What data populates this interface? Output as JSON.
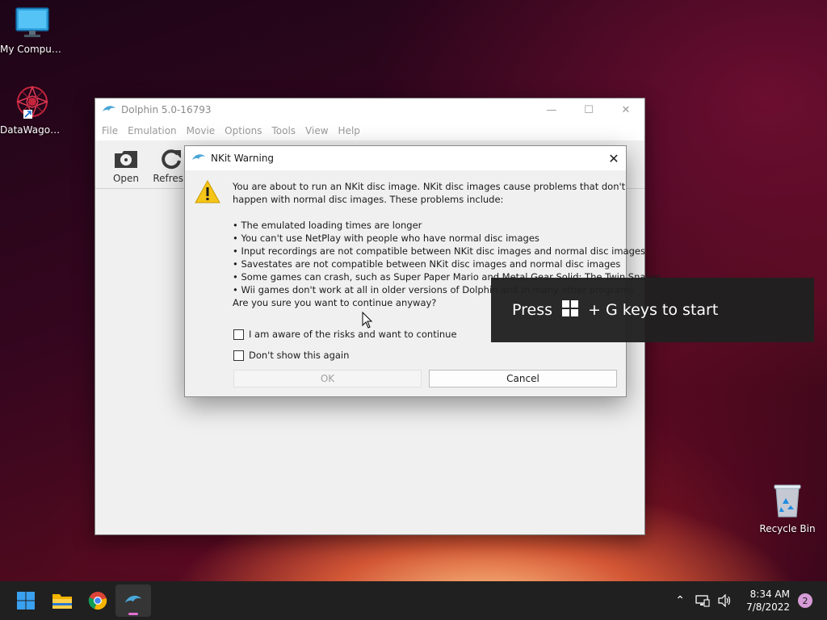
{
  "desktop": {
    "icons": [
      {
        "label": "My Computer"
      },
      {
        "label": "DataWagon..."
      },
      {
        "label": "Recycle Bin"
      }
    ]
  },
  "dolphin": {
    "title": "Dolphin 5.0-16793",
    "menu": [
      "File",
      "Emulation",
      "Movie",
      "Options",
      "Tools",
      "View",
      "Help"
    ],
    "toolbar": {
      "open_label": "Open",
      "refresh_label": "Refresh"
    }
  },
  "dialog": {
    "title": "NKit Warning",
    "intro_line1": "You are about to run an NKit disc image. NKit disc images cause problems that don't",
    "intro_line2": "happen with normal disc images. These problems include:",
    "bullets": [
      "The emulated loading times are longer",
      "You can't use NetPlay with people who have normal disc images",
      "Input recordings are not compatible between NKit disc images and normal disc images",
      "Savestates are not compatible between NKit disc images and normal disc images",
      "Some games can crash, such as Super Paper Mario and Metal Gear Solid: The Twin Snakes",
      "Wii games don't work at all in older versions of Dolphin and in many other programs"
    ],
    "question": "Are you sure you want to continue anyway?",
    "checkbox_aware": "I am aware of the risks and want to continue",
    "checkbox_dontshow": "Don't show this again",
    "ok_label": "OK",
    "cancel_label": "Cancel"
  },
  "toast": {
    "press": "Press",
    "rest": "+ G keys to start"
  },
  "taskbar": {
    "time": "8:34 AM",
    "date": "7/8/2022",
    "notification_count": "2"
  },
  "colors": {
    "taskbar_bg": "#202020",
    "dialog_bg": "#f0f0f0",
    "accent_indicator": "#e36fd1",
    "warning_yellow": "#f5c518"
  }
}
